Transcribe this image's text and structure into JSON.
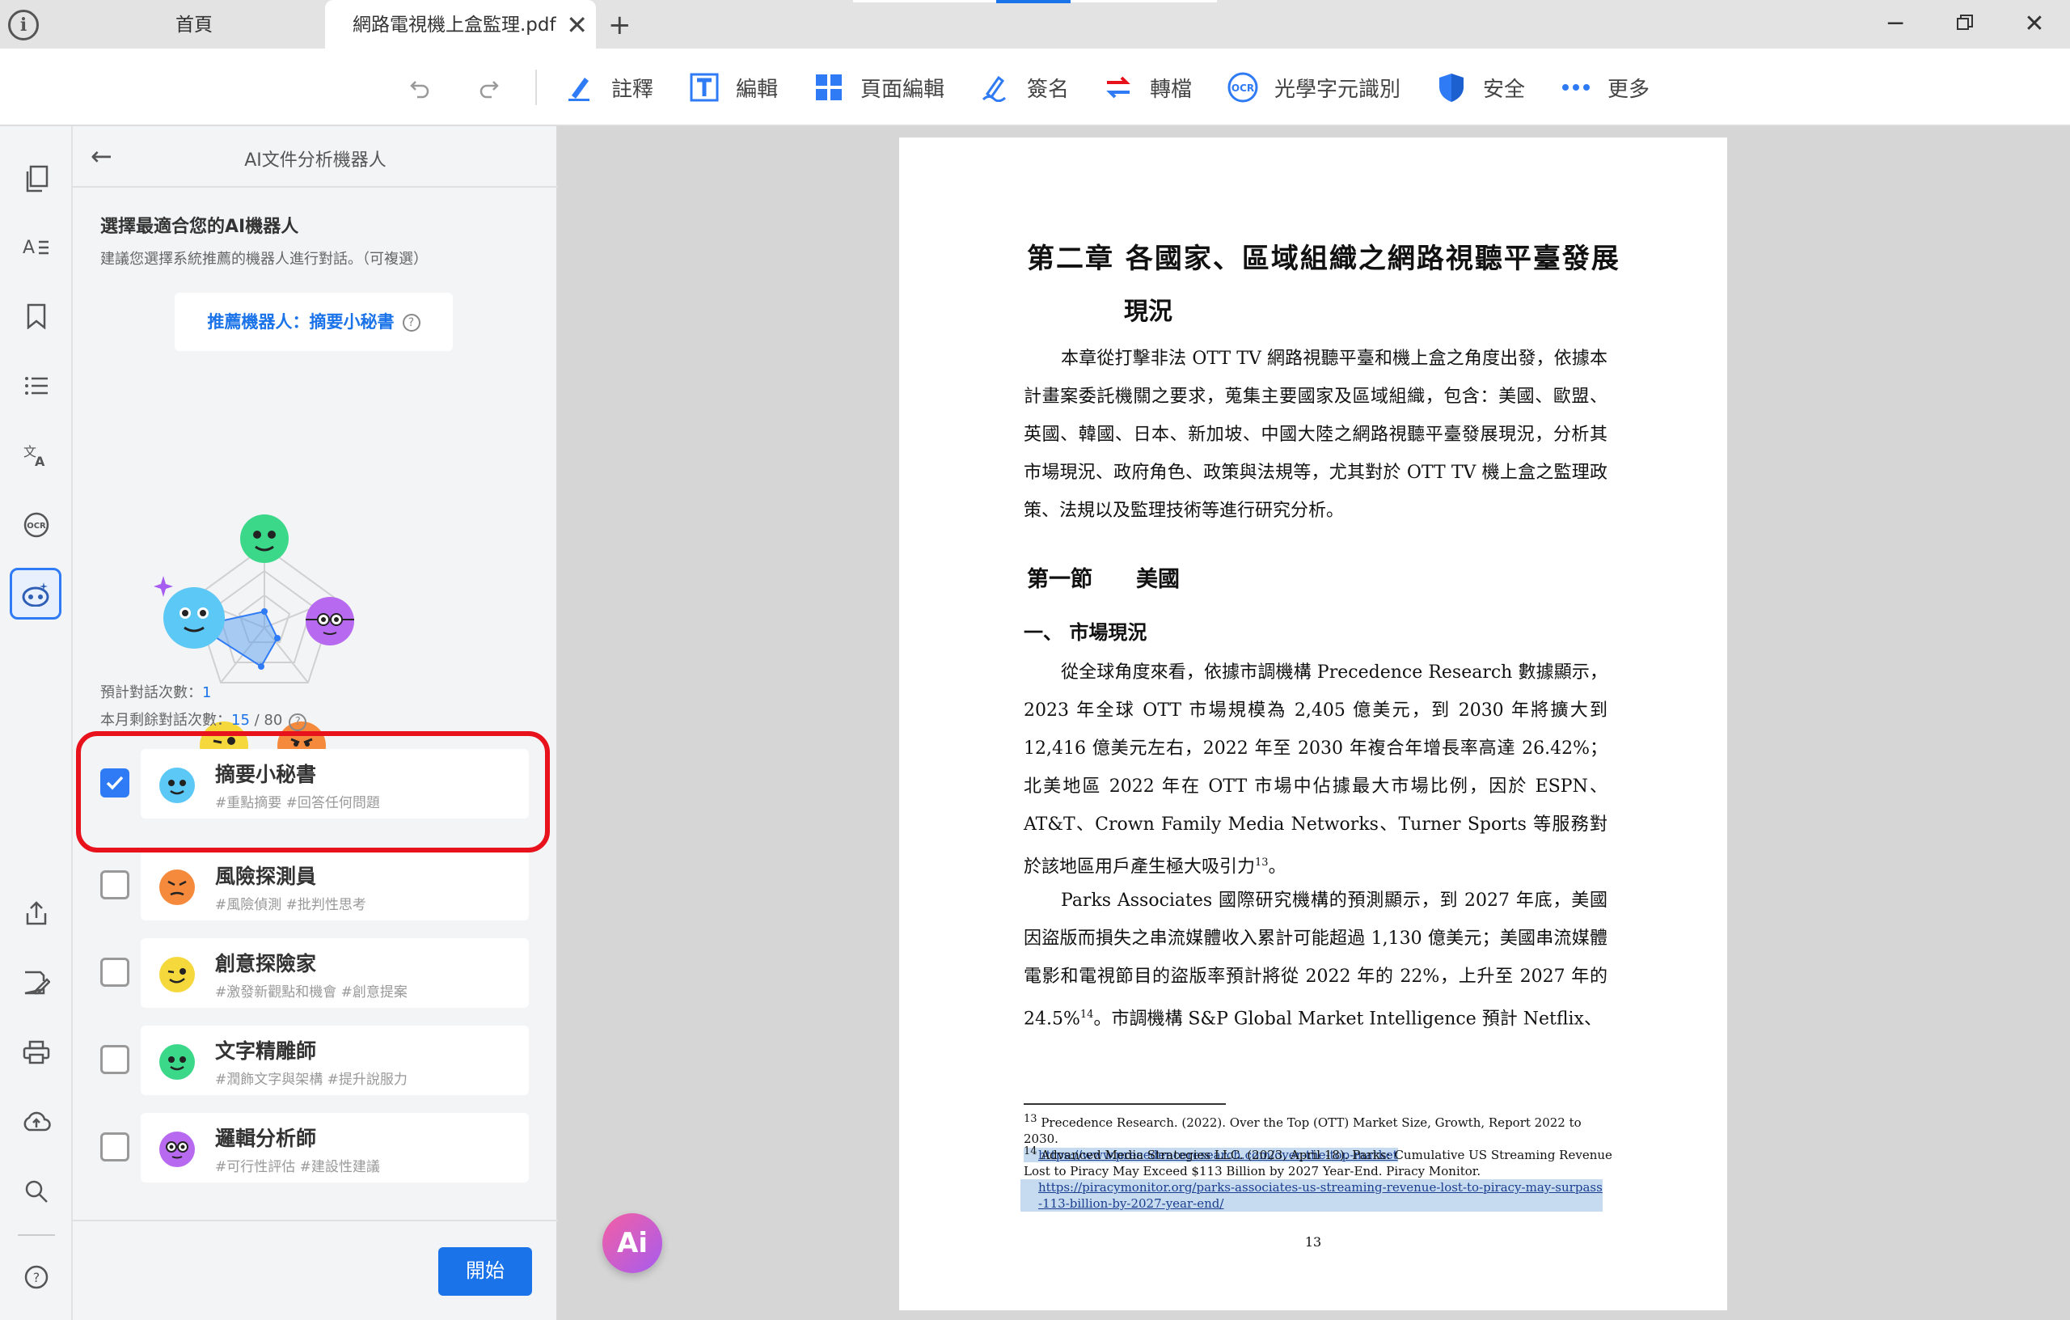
{
  "tabs": {
    "home_label": "首頁",
    "file_label": "網路電視機上盒監理.pdf"
  },
  "toolbar": {
    "annotate": "註釋",
    "edit": "編輯",
    "page_edit": "頁面編輯",
    "sign": "簽名",
    "convert": "轉檔",
    "ocr": "光學字元識別",
    "security": "安全",
    "more": "更多"
  },
  "panel": {
    "title": "AI文件分析機器人",
    "choose_title": "選擇最適合您的AI機器人",
    "choose_sub": "建議您選擇系統推薦的機器人進行對話。（可複選）",
    "recommend": "推薦機器人：摘要小秘書",
    "estimate_label": "預計對話次數：",
    "estimate_value": "1",
    "remain_label": "本月剩餘對話次數：",
    "remain_value": "15",
    "remain_total": " / 80",
    "start": "開始",
    "bots": [
      {
        "name": "摘要小秘書",
        "tags": "#重點摘要 #回答任何問題",
        "checked": true,
        "color": "#5bc8f5"
      },
      {
        "name": "風險探測員",
        "tags": "#風險偵測 #批判性思考",
        "checked": false,
        "color": "#f58a3c"
      },
      {
        "name": "創意探險家",
        "tags": "#激發新觀點和機會 #創意提案",
        "checked": false,
        "color": "#f5d83c"
      },
      {
        "name": "文字精雕師",
        "tags": "#潤飾文字與架構 #提升說服力",
        "checked": false,
        "color": "#3cd88a"
      },
      {
        "name": "邏輯分析師",
        "tags": "#可行性評估 #建設性建議",
        "checked": false,
        "color": "#b76af0"
      }
    ]
  },
  "document": {
    "chapter_title": "第二章 各國家、區域組織之網路視聽平臺發展",
    "chapter_title_2": "現況",
    "intro": "本章從打擊非法 OTT TV 網路視聽平臺和機上盒之角度出發，依據本計畫案委託機關之要求，蒐集主要國家及區域組織，包含：美國、歐盟、英國、韓國、日本、新加坡、中國大陸之網路視聽平臺發展現況，分析其市場現況、政府角色、政策與法規等，尤其對於 OTT TV 機上盒之監理政策、法規以及監理技術等進行研究分析。",
    "section": "第一節　　美國",
    "subsection": "一、 市場現況",
    "para1": "從全球角度來看，依據市調機構 Precedence Research 數據顯示，2023 年全球 OTT 市場規模為 2,405 億美元，到 2030 年將擴大到 12,416 億美元左右，2022 年至 2030 年複合年增長率高達 26.42%；北美地區 2022 年在 OTT 市場中佔據最大市場比例，因於 ESPN、AT&T、Crown Family Media Networks、Turner Sports 等服務對於該地區用戶產生極大吸引力",
    "para1_sup": "13",
    "para1_end": "。",
    "para2": "Parks Associates 國際研究機構的預測顯示，到 2027 年底，美國因盜版而損失之串流媒體收入累計可能超過 1,130 億美元；美國串流媒體電影和電視節目的盜版率預計將從 2022 年的 22%，上升至 2027 年的 24.5%",
    "para2_sup": "14",
    "para2_end": "。市調機構 S&P Global Market Intelligence 預計 Netflix、",
    "fn13": "Precedence Research. (2022). Over the Top (OTT) Market Size, Growth, Report 2022 to 2030.",
    "fn13_url": "https://www.precedenceresearch.com/over-the-top-market",
    "fn14": "Advanced Media Strategies LLC. (2023, April 18). Parks: Cumulative US Streaming Revenue Lost to Piracy May Exceed $113 Billion by 2027 Year-End. Piracy Monitor.",
    "fn14_url": "https://piracymonitor.org/parks-associates-us-streaming-revenue-lost-to-piracy-may-surpass-113-billion-by-2027-year-end/",
    "fn13_no": "13",
    "fn14_no": "14",
    "page_number": "13"
  },
  "ai_fab": "Ai"
}
